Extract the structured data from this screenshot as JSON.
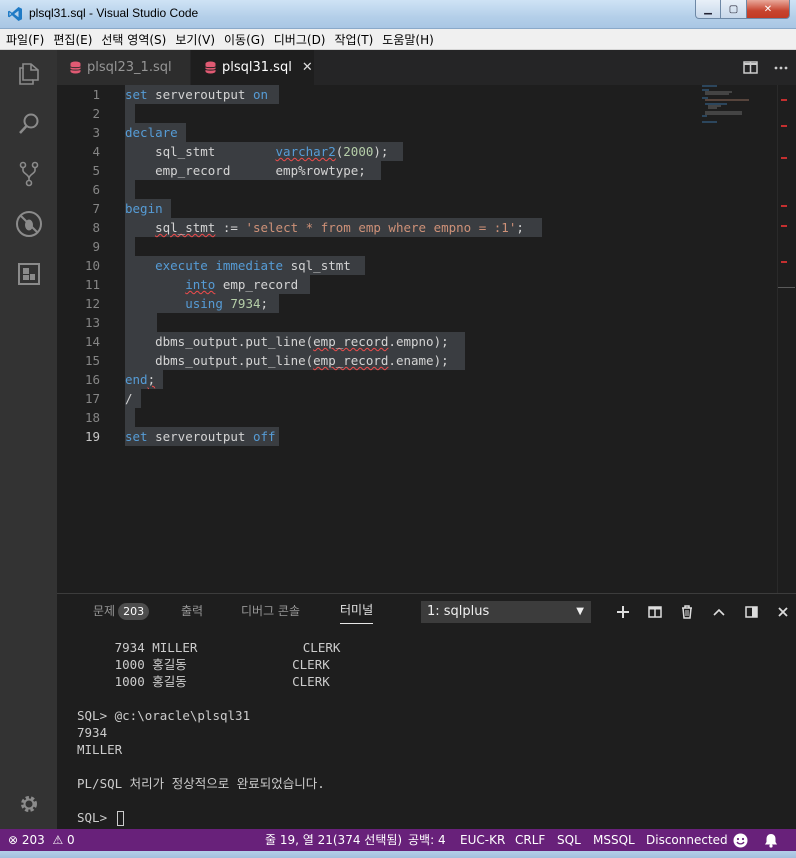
{
  "window": {
    "title": "plsql31.sql - Visual Studio Code",
    "buttons": {
      "minimize": "▁",
      "maximize": "▢",
      "close": "✕"
    }
  },
  "menu": [
    "파일(F)",
    "편집(E)",
    "선택 영역(S)",
    "보기(V)",
    "이동(G)",
    "디버그(D)",
    "작업(T)",
    "도움말(H)"
  ],
  "activity_icons": [
    "explorer-icon",
    "search-icon",
    "source-control-icon",
    "debug-icon",
    "extensions-icon",
    "settings-gear-icon"
  ],
  "tabs": [
    {
      "label": "plsql23_1.sql",
      "active": false
    },
    {
      "label": "plsql31.sql",
      "active": true,
      "close": "✕"
    }
  ],
  "editor": {
    "line_numbers": [
      "1",
      "2",
      "3",
      "4",
      "5",
      "6",
      "7",
      "8",
      "9",
      "10",
      "11",
      "12",
      "13",
      "14",
      "15",
      "16",
      "17",
      "18",
      "19"
    ],
    "active_line": "19"
  },
  "panel": {
    "tabs": {
      "problems": "문제",
      "problems_count": "203",
      "output": "출력",
      "debug_console": "디버그 콘솔",
      "terminal": "터미널"
    },
    "terminal_select": "1: sqlplus",
    "terminal_lines": [
      "     7934 MILLER              CLERK",
      "     1000 홍길동              CLERK",
      "     1000 홍길동              CLERK",
      "",
      "SQL> @c:\\oracle\\plsql31",
      "7934",
      "MILLER",
      "",
      "PL/SQL 처리가 정상적으로 완료되었습니다.",
      "",
      "SQL> "
    ]
  },
  "statusbar": {
    "errors": "203",
    "warnings": "0",
    "position": "줄 19, 열 21(374 선택됨)",
    "indent": "공백: 4",
    "encoding": "EUC-KR",
    "eol": "CRLF",
    "language": "SQL",
    "connection_type": "MSSQL",
    "connection_status": "Disconnected"
  },
  "colors": {
    "statusbar": "#68217a",
    "keyword": "#569cd6",
    "string": "#ce9178",
    "number": "#b5cea8"
  }
}
